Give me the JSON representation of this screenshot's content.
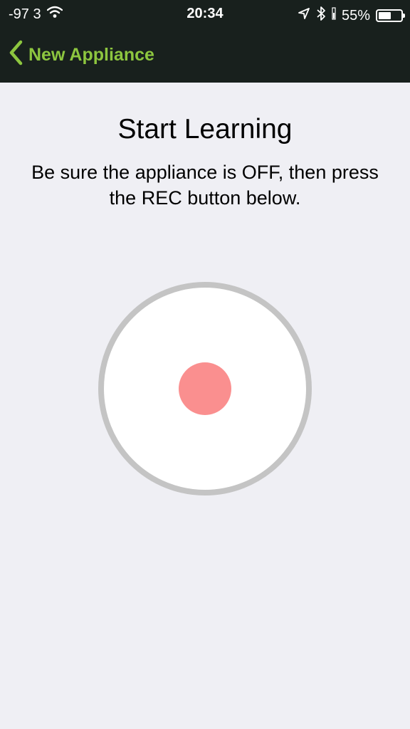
{
  "status_bar": {
    "signal": "-97 3",
    "time": "20:34",
    "battery_percent": "55%",
    "battery_level": 0.55,
    "icons": [
      "wifi-icon",
      "location-arrow-icon",
      "bluetooth-icon",
      "battery-icon"
    ]
  },
  "nav": {
    "back_label": "New Appliance"
  },
  "content": {
    "title": "Start Learning",
    "description": "Be sure the appliance is OFF, then press the REC button below."
  },
  "colors": {
    "nav_background": "#18201d",
    "accent": "#8dc63f",
    "page_background": "#efeff4",
    "rec_dot": "#fa8f8f",
    "rec_ring": "#c4c4c4"
  }
}
